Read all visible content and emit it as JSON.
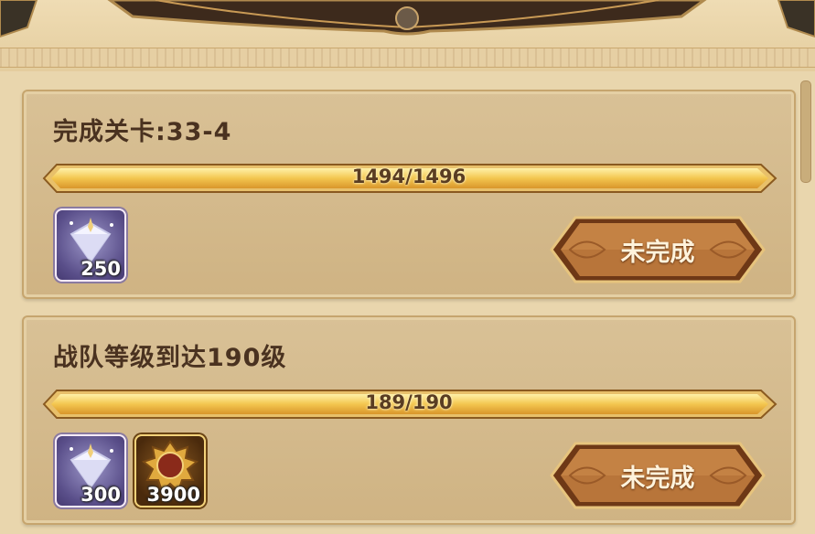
{
  "quests": [
    {
      "title": "完成关卡:33-4",
      "progress_text": "1494/1496",
      "progress_fraction": 0.9987,
      "rewards": [
        {
          "icon": "diamond-icon",
          "quantity": "250"
        }
      ],
      "status_label": "未完成"
    },
    {
      "title": "战队等级到达190级",
      "progress_text": "189/190",
      "progress_fraction": 0.9947,
      "rewards": [
        {
          "icon": "diamond-icon",
          "quantity": "300"
        },
        {
          "icon": "adventure-medal-icon",
          "quantity": "3900"
        }
      ],
      "status_label": "未完成"
    }
  ]
}
